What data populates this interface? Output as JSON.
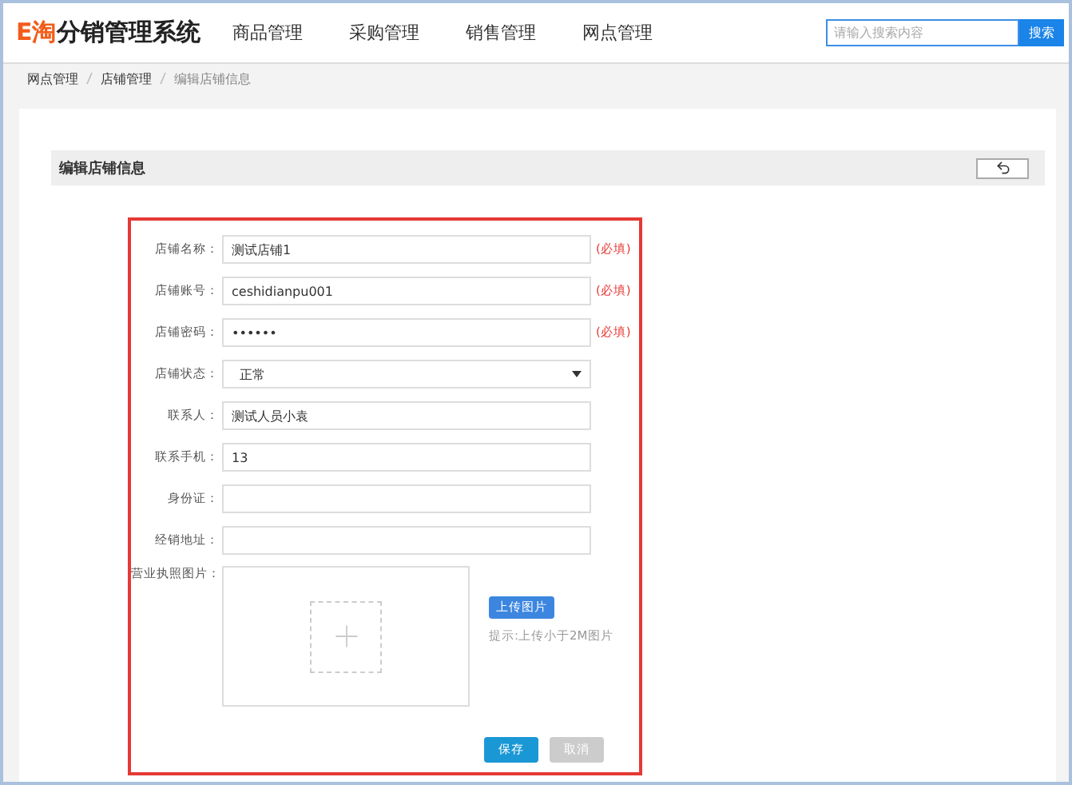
{
  "header": {
    "logo_mark": "E淘",
    "logo_text": "分销管理系统",
    "nav": [
      "商品管理",
      "采购管理",
      "销售管理",
      "网点管理"
    ],
    "search": {
      "placeholder": "请输入搜索内容",
      "button": "搜索"
    }
  },
  "breadcrumb": [
    "网点管理",
    "店铺管理",
    "编辑店铺信息"
  ],
  "panel": {
    "title": "编辑店铺信息"
  },
  "form": {
    "fields": [
      {
        "kind": "text",
        "label": "店铺名称：",
        "value": "测试店铺1",
        "note": "(必填)"
      },
      {
        "kind": "text",
        "label": "店铺账号：",
        "value": "ceshidianpu001",
        "note": "(必填)"
      },
      {
        "kind": "text",
        "label": "店铺密码：",
        "value": "••••••",
        "note": "(必填)"
      },
      {
        "kind": "select",
        "label": "店铺状态：",
        "value": "正常"
      },
      {
        "kind": "text",
        "label": "联系人：",
        "value": "测试人员小袁"
      },
      {
        "kind": "text",
        "label": "联系手机：",
        "value": "13"
      },
      {
        "kind": "text",
        "label": "身份证："
      },
      {
        "kind": "text",
        "label": "经销地址："
      }
    ],
    "image": {
      "label": "营业执照图片：",
      "upload_button": "上传图片",
      "hint": "提示:上传小于2M图片"
    },
    "buttons": [
      {
        "label": "保存",
        "disabled": false
      },
      {
        "label": "取消",
        "disabled": true
      }
    ]
  }
}
